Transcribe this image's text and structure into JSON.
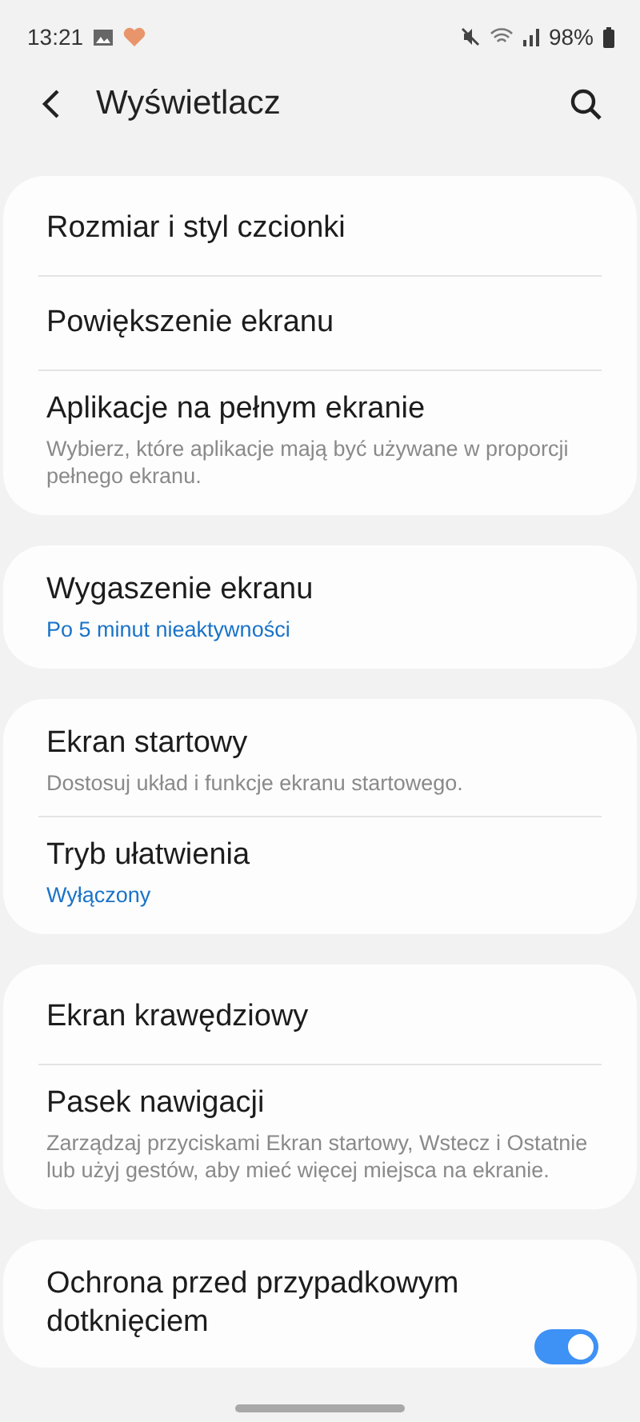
{
  "status_bar": {
    "time": "13:21",
    "battery": "98%"
  },
  "header": {
    "title": "Wyświetlacz"
  },
  "groups": [
    {
      "items": [
        {
          "kind": "plain",
          "title": "Rozmiar i styl czcionki"
        },
        {
          "kind": "plain",
          "title": "Powiększenie ekranu"
        },
        {
          "kind": "description",
          "title": "Aplikacje na pełnym ekranie",
          "subtitle": "Wybierz, które aplikacje mają być używane w proporcji pełnego ekranu."
        }
      ]
    },
    {
      "items": [
        {
          "kind": "value",
          "title": "Wygaszenie ekranu",
          "subtitle": "Po 5 minut nieaktywności"
        }
      ]
    },
    {
      "items": [
        {
          "kind": "description",
          "title": "Ekran startowy",
          "subtitle": "Dostosuj układ i funkcje ekranu startowego."
        },
        {
          "kind": "value",
          "title": "Tryb ułatwienia",
          "subtitle": "Wyłączony"
        }
      ]
    },
    {
      "items": [
        {
          "kind": "plain",
          "title": "Ekran krawędziowy"
        },
        {
          "kind": "description",
          "title": "Pasek nawigacji",
          "subtitle": "Zarządzaj przyciskami Ekran startowy, Wstecz i Ostatnie lub użyj gestów, aby mieć więcej miejsca na ekranie."
        }
      ]
    },
    {
      "items": [
        {
          "kind": "toggle",
          "title": "Ochrona przed przypadkowym dotknięciem",
          "on": true
        }
      ]
    }
  ]
}
